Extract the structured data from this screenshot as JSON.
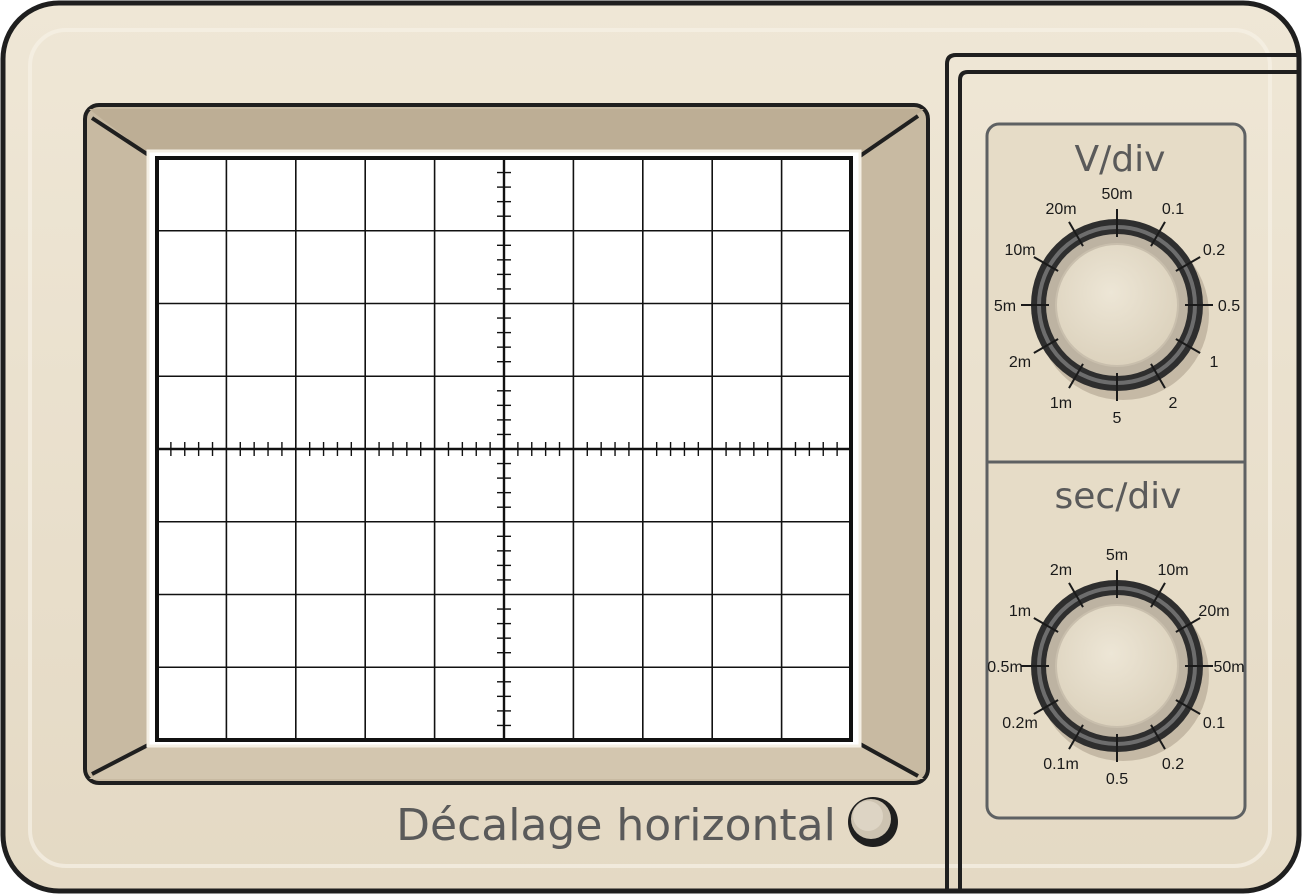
{
  "screen": {
    "columns": 10,
    "rows": 8,
    "minor_ticks_per_division": 5
  },
  "volts_panel": {
    "title": "V/div",
    "labels": [
      "5m",
      "10m",
      "20m",
      "50m",
      "0.1",
      "0.2",
      "0.5",
      "1",
      "2",
      "5",
      "1m",
      "2m"
    ]
  },
  "time_panel": {
    "title": "sec/div",
    "labels": [
      "0.5m",
      "1m",
      "2m",
      "5m",
      "10m",
      "20m",
      "50m",
      "0.1",
      "0.2",
      "0.5",
      "0.1m",
      "0.2m"
    ]
  },
  "horizontal_offset": {
    "label": "Décalage horizontal"
  },
  "colors": {
    "body": "#e9e0cd",
    "bezel": "#c7b9a1",
    "outline": "#1f1f1f",
    "knob_ring": "#333333",
    "knob_face": "#e7dfcd",
    "text": "#5a5a5a"
  }
}
